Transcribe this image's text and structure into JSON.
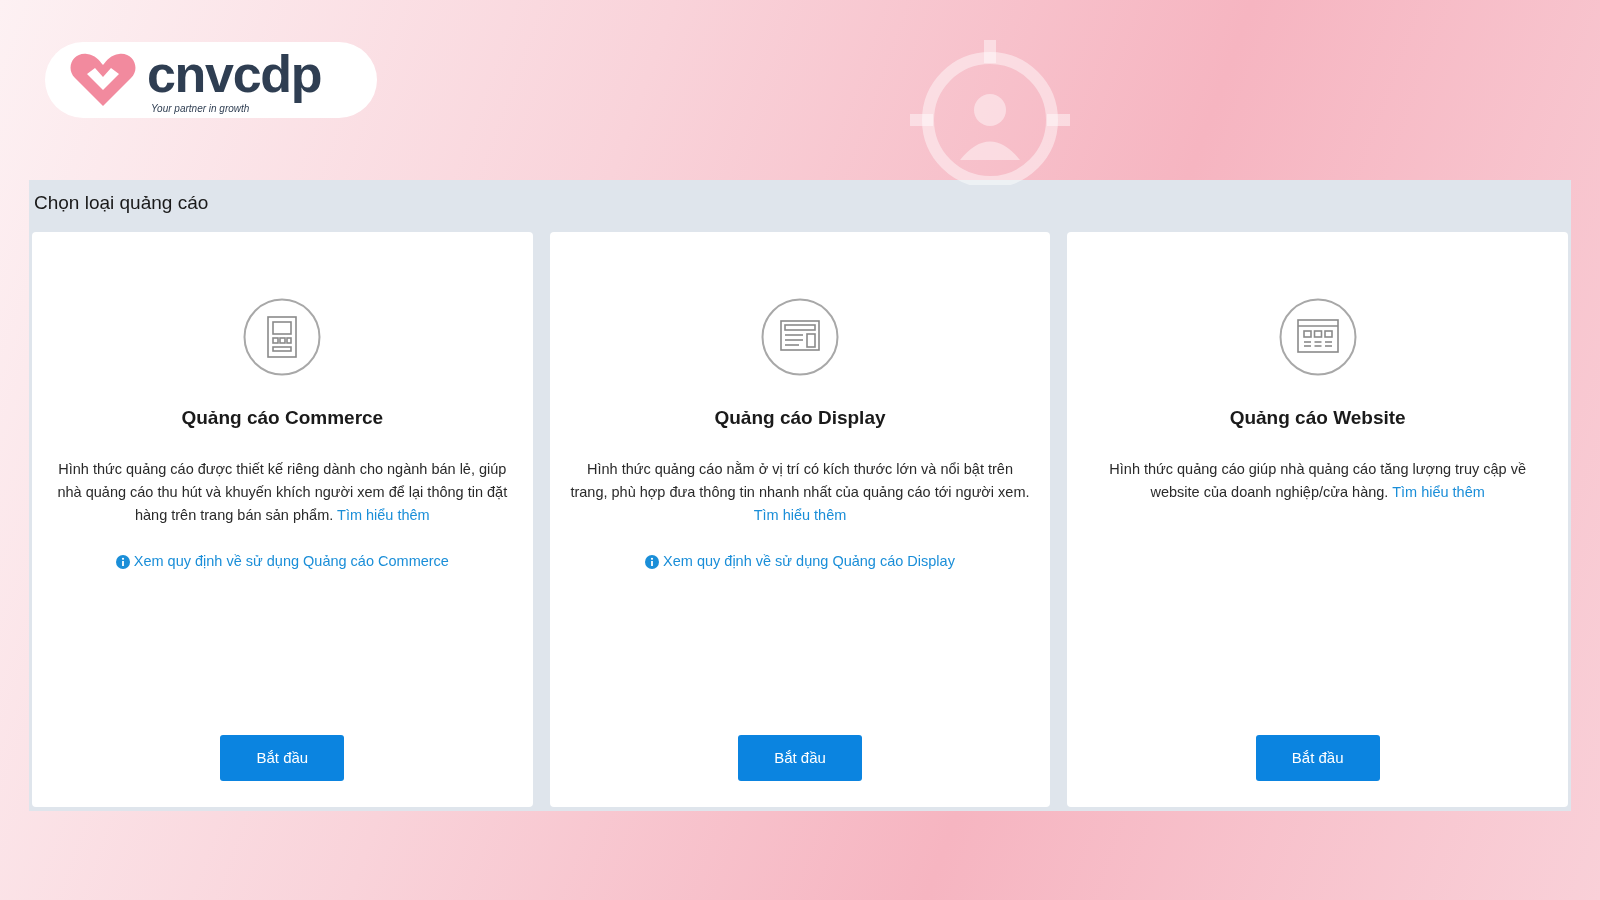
{
  "logo": {
    "wordmark": "cnvcdp",
    "tagline": "Your partner in growth"
  },
  "panel": {
    "title": "Chọn loại quảng cáo",
    "cards": [
      {
        "kind": "commerce",
        "title": "Quảng cáo Commerce",
        "description": "Hình thức quảng cáo được thiết kế riêng dành cho ngành bán lẻ, giúp nhà quảng cáo thu hút và khuyến khích người xem để lại thông tin đặt hàng trên trang bán sản phẩm.",
        "more_link": "Tìm hiểu thêm",
        "policy_link": "Xem quy định về sử dụng Quảng cáo Commerce",
        "button": "Bắt đầu"
      },
      {
        "kind": "display",
        "title": "Quảng cáo Display",
        "description": "Hình thức quảng cáo nằm ở vị trí có kích thước lớn và nổi bật trên trang, phù hợp đưa thông tin nhanh nhất của quảng cáo tới người xem.",
        "more_link": "Tìm hiểu thêm",
        "policy_link": "Xem quy định về sử dụng Quảng cáo Display",
        "button": "Bắt đầu"
      },
      {
        "kind": "website",
        "title": "Quảng cáo Website",
        "description": "Hình thức quảng cáo giúp nhà quảng cáo tăng lượng truy cập về website của doanh nghiệp/cửa hàng.",
        "more_link": "Tìm hiểu thêm",
        "button": "Bắt đầu"
      }
    ]
  }
}
